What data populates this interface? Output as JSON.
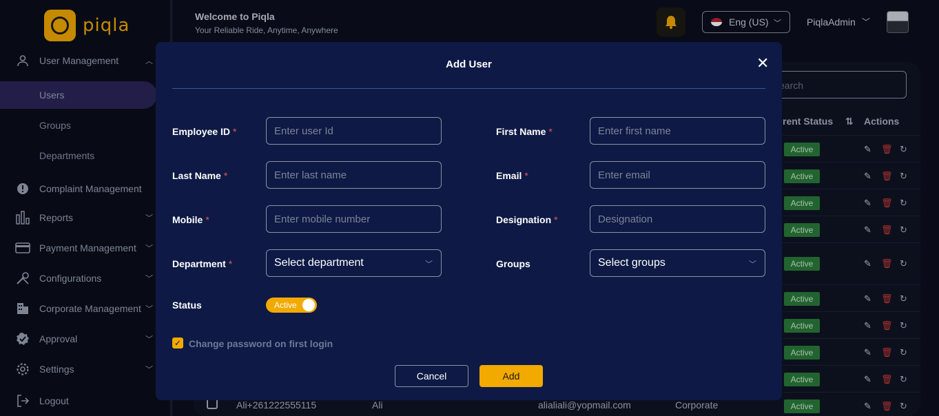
{
  "app": {
    "brand": "piqla",
    "header_title": "Welcome to Piqla",
    "header_subtitle": "Your Reliable Ride, Anytime, Anywhere",
    "language": "Eng (US)",
    "user_name": "PiqlaAdmin"
  },
  "sidebar": {
    "items": [
      {
        "label": "User Management",
        "icon": "user-icon"
      },
      {
        "label": "Users"
      },
      {
        "label": "Groups"
      },
      {
        "label": "Departments"
      },
      {
        "label": "Complaint Management",
        "icon": "alert-icon"
      },
      {
        "label": "Reports",
        "icon": "bar-chart-icon"
      },
      {
        "label": "Payment Management",
        "icon": "card-icon"
      },
      {
        "label": "Configurations",
        "icon": "tools-icon"
      },
      {
        "label": "Corporate Management",
        "icon": "building-icon"
      },
      {
        "label": "Approval",
        "icon": "badge-icon"
      },
      {
        "label": "Settings",
        "icon": "gear-icon"
      },
      {
        "label": "Logout",
        "icon": "logout-icon"
      }
    ]
  },
  "background_table": {
    "search_placeholder": "earch",
    "col_status": "rent Status",
    "col_actions": "Actions",
    "status_value": "Active",
    "last_row": {
      "id": "Ali+261222555115",
      "name": "Ali",
      "email": "alialiali@yopmail.com",
      "type": "Corporate",
      "status": "Active"
    }
  },
  "modal": {
    "title": "Add User",
    "fields": {
      "employee_id": {
        "label": "Employee ID",
        "placeholder": "Enter user Id"
      },
      "first_name": {
        "label": "First Name",
        "placeholder": "Enter first name"
      },
      "last_name": {
        "label": "Last Name",
        "placeholder": "Enter last name"
      },
      "email": {
        "label": "Email",
        "placeholder": "Enter email"
      },
      "mobile": {
        "label": "Mobile",
        "placeholder": "Enter mobile number"
      },
      "designation": {
        "label": "Designation",
        "placeholder": "Designation"
      },
      "department": {
        "label": "Department",
        "value": "Select department"
      },
      "groups": {
        "label": "Groups",
        "value": "Select groups"
      },
      "status": {
        "label": "Status",
        "value": "Active"
      }
    },
    "required_mark": "*",
    "change_password_label": "Change password on first login",
    "cancel_label": "Cancel",
    "add_label": "Add"
  },
  "colors": {
    "accent": "#f2a900",
    "modal_bg": "#0e1a45",
    "active_badge": "#2a7a3a"
  }
}
